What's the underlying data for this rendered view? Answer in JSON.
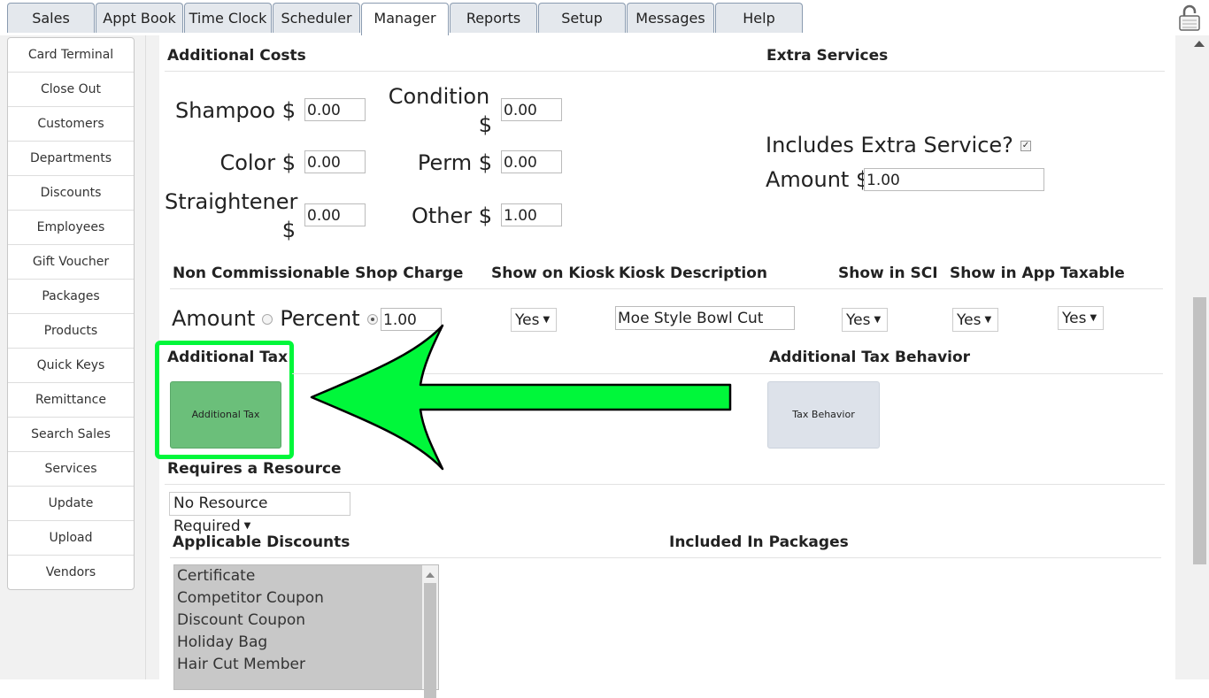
{
  "nav": {
    "tabs": [
      "Sales",
      "Appt Book",
      "Time Clock",
      "Scheduler",
      "Manager",
      "Reports",
      "Setup",
      "Messages",
      "Help"
    ],
    "active": "Manager"
  },
  "sidebar": {
    "items": [
      "Card Terminal",
      "Close Out",
      "Customers",
      "Departments",
      "Discounts",
      "Employees",
      "Gift Voucher",
      "Packages",
      "Products",
      "Quick Keys",
      "Remittance",
      "Search Sales",
      "Services",
      "Update",
      "Upload",
      "Vendors"
    ]
  },
  "additional_costs": {
    "heading": "Additional Costs",
    "shampoo": {
      "label": "Shampoo $",
      "value": "0.00"
    },
    "condition": {
      "label1": "Condition",
      "label2": "$",
      "value": "0.00"
    },
    "color": {
      "label": "Color $",
      "value": "0.00"
    },
    "perm": {
      "label": "Perm $",
      "value": "0.00"
    },
    "straightener": {
      "label1": "Straightener",
      "label2": "$",
      "value": "0.00"
    },
    "other": {
      "label": "Other $",
      "value": "1.00"
    }
  },
  "extra_services": {
    "heading": "Extra Services",
    "includes_label": "Includes Extra Service?",
    "includes_checked": true,
    "amount_label": "Amount $",
    "amount_value": "1.00"
  },
  "shop_charge": {
    "headers": {
      "charge": "Non Commissionable Shop Charge",
      "kiosk": "Show on Kiosk",
      "kiosk_desc": "Kiosk Description",
      "sci": "Show in SCI",
      "app": "Show in App",
      "taxable": "Taxable"
    },
    "amount_label": "Amount",
    "percent_label": "Percent",
    "selected": "Percent",
    "value": "1.00",
    "kiosk_value": "Yes",
    "kiosk_desc_value": "Moe Style Bowl Cut",
    "sci_value": "Yes",
    "app_value": "Yes",
    "taxable_value": "Yes"
  },
  "additional_tax": {
    "heading": "Additional Tax",
    "button_label": "Additional Tax",
    "button_color": "#6bbf7a",
    "highlight_color": "#00f73a"
  },
  "tax_behavior": {
    "heading": "Additional Tax Behavior",
    "button_label": "Tax Behavior"
  },
  "resource": {
    "heading": "Requires a Resource",
    "value": "No Resource Required"
  },
  "discounts": {
    "heading": "Applicable Discounts",
    "items": [
      "Certificate",
      "Competitor Coupon",
      "Discount Coupon",
      "Holiday Bag",
      "Hair Cut Member"
    ]
  },
  "packages": {
    "heading": "Included In Packages"
  }
}
